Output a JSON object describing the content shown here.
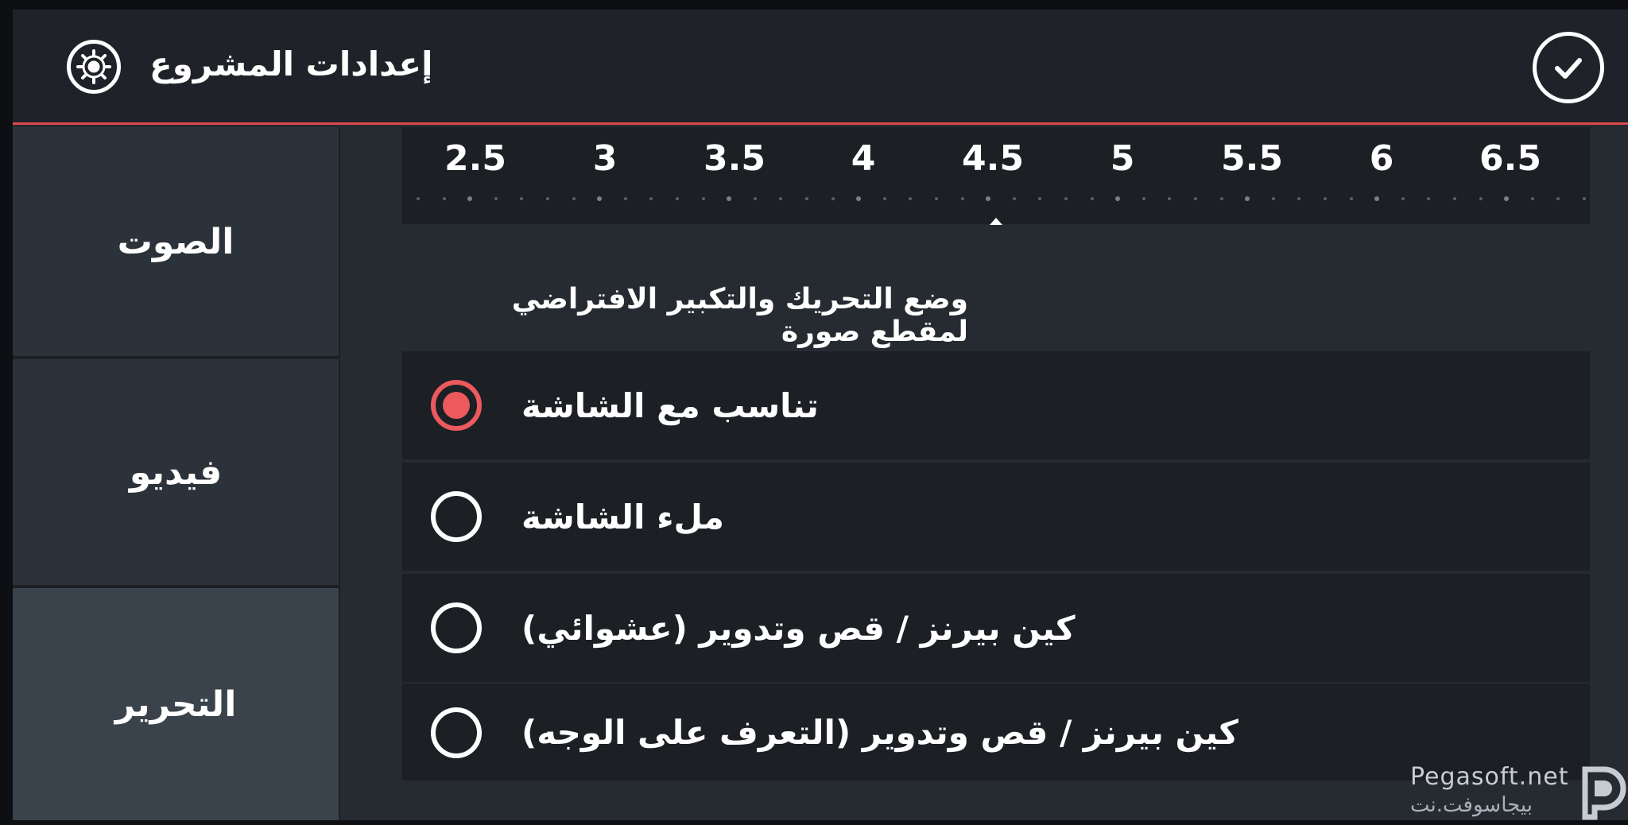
{
  "header": {
    "title": "إعدادات المشروع",
    "settings_icon": "gear-icon",
    "confirm_icon": "check-icon"
  },
  "sidebar": {
    "items": [
      {
        "label": "الصوت",
        "active": false
      },
      {
        "label": "فيديو",
        "active": false
      },
      {
        "label": "التحرير",
        "active": true
      }
    ]
  },
  "ruler": {
    "labels": [
      "2.5",
      "3",
      "3.5",
      "4",
      "4.5",
      "5",
      "5.5",
      "6",
      "6.5"
    ],
    "selected_value": 4.5
  },
  "pan_zoom": {
    "section_label": "وضع التحريك والتكبير الافتراضي لمقطع صورة",
    "options": [
      {
        "label": "تناسب مع الشاشة",
        "selected": true
      },
      {
        "label": "ملء الشاشة",
        "selected": false
      },
      {
        "label": "كين بيرنز / قص وتدوير (عشوائي)",
        "selected": false
      },
      {
        "label": "كين بيرنز / قص وتدوير (التعرف على الوجه)",
        "selected": false
      }
    ]
  },
  "watermark": {
    "text": "Pegasoft.net",
    "sub_text": "بيجاسوفت.نت"
  },
  "colors": {
    "accent": "#ec5a5e",
    "header_bg": "#1f2329",
    "panel_bg": "#1c2025",
    "page_bg": "#262b31"
  }
}
